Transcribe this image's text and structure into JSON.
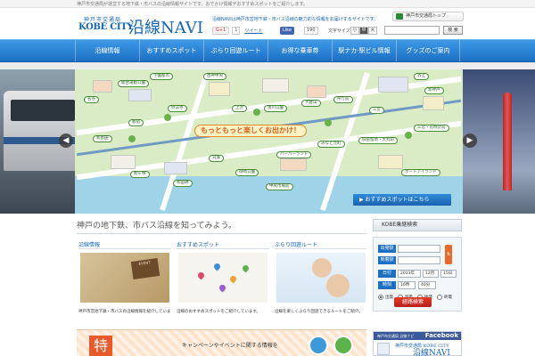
{
  "top_strip": {
    "text": "神戸市交通局が運営する地下鉄・市バスの沿線情報サイトです。おでかけ情報やおすすめスポットをご紹介します。"
  },
  "header": {
    "logo": {
      "small": "神戸市交通局",
      "kobe": "KOBE CITY",
      "navi": "沿線NAVI"
    },
    "description": "沿線NAVIは神戸市営地下鉄・市バス沿線の魅力的な情報をお届けするサイトです。",
    "social": {
      "gplus_label": "G+1",
      "gplus_count": "1",
      "tweet_label": "ツイート",
      "fb_like_label": "Like",
      "fb_like_count": "190"
    },
    "font_size": {
      "label": "文字サイズ",
      "small": "小",
      "medium": "中",
      "large": "大"
    },
    "site_top_label": "神戸市交通局トップ",
    "search": {
      "placeholder": "",
      "button_label": "検 索"
    }
  },
  "nav": {
    "items": [
      {
        "label": "沿線情報"
      },
      {
        "label": "おすすめスポット"
      },
      {
        "label": "ぶらり回遊ルート"
      },
      {
        "label": "お得な乗車券"
      },
      {
        "label": "駅ナカ·駅ビル情報"
      },
      {
        "label": "グッズのご案内"
      }
    ]
  },
  "hero": {
    "banner": "もっともっと楽しくお出かけ！",
    "cta": "▶ おすすめスポットはこちら",
    "prev_label": "◀",
    "next_label": "▶",
    "stations": [
      {
        "label": "名谷"
      },
      {
        "label": "総合運動公園"
      },
      {
        "label": "学園都市"
      },
      {
        "label": "西神中央"
      },
      {
        "label": "新長田"
      },
      {
        "label": "板宿"
      },
      {
        "label": "三宮"
      },
      {
        "label": "新神戸"
      },
      {
        "label": "谷上"
      },
      {
        "label": "妙法寺"
      },
      {
        "label": "上沢"
      },
      {
        "label": "湊川公園"
      },
      {
        "label": "大倉山"
      },
      {
        "label": "県庁前"
      },
      {
        "label": "ハーバーランド"
      },
      {
        "label": "みなと元町"
      },
      {
        "label": "旧居留地・大丸前"
      },
      {
        "label": "三宮・花時計前"
      },
      {
        "label": "和田岬"
      },
      {
        "label": "御崎公園"
      },
      {
        "label": "中央市場前"
      },
      {
        "label": "駒ヶ林"
      },
      {
        "label": "苅藻"
      },
      {
        "label": "ポートアイランド"
      }
    ]
  },
  "main": {
    "heading": "神戸の地下鉄、市バス沿線を知ってみよう。",
    "columns": [
      {
        "title": "沿線情報",
        "text": "神戸市営地下鉄・市バスの沿線情報を紹介しています。",
        "img_caption": "EVENT"
      },
      {
        "title": "おすすめスポット",
        "text": "沿線のおすすめスポットをご紹介しています。"
      },
      {
        "title": "ぶらり回遊ルート",
        "text": "沿線を楽しくぶらり回遊できるルートをご紹介。"
      }
    ],
    "promo": {
      "kanji": "特集",
      "text": "キャンペーンやイベントに関する情報を"
    }
  },
  "sidebar": {
    "title": "KOBE乗継検索",
    "from_label": "出発駅",
    "to_label": "到着駅",
    "date_label": "日付",
    "time_label": "時刻",
    "swap_label": "⇅",
    "date_year": "2013年",
    "date_month": "12月",
    "date_day": "15日",
    "time_hour": "16時",
    "time_min": "40分",
    "radio_depart": "出発",
    "radio_arrive": "到着",
    "radio_first": "始発",
    "radio_last": "終電",
    "submit_label": "経路検索"
  },
  "fb_box": {
    "sub": "神戸市交通局 沿線ナビ",
    "title": "Facebook",
    "body": "神戸市交通局 KOBE CITY",
    "navi": "沿線NAVI"
  }
}
